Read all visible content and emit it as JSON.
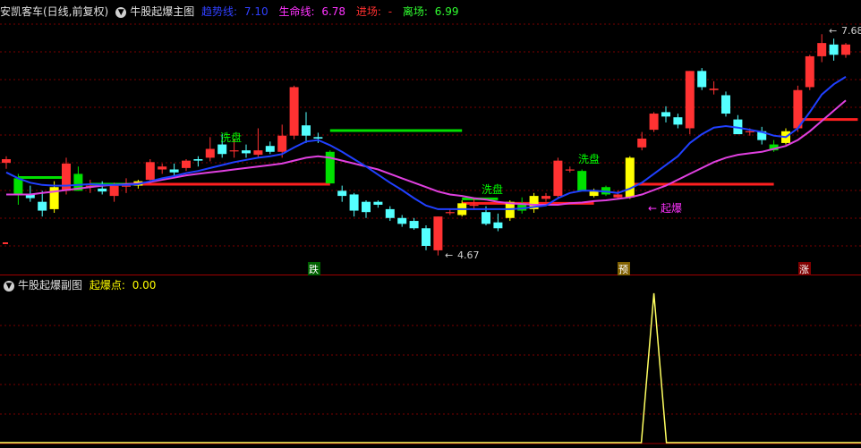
{
  "main_panel": {
    "stock_name": "安凯客车(日线,前复权)",
    "indicator_name": "牛股起爆主图",
    "values": [
      {
        "label": "趋势线:",
        "value": "7.10",
        "color": "#3040ff"
      },
      {
        "label": "生命线:",
        "value": "6.78",
        "color": "#ff33ff"
      },
      {
        "label": "进场:",
        "value": "-",
        "color": "#ff3030"
      },
      {
        "label": "离场:",
        "value": "6.99",
        "color": "#30ff30"
      }
    ],
    "annotations": {
      "wash1": "洗盘",
      "wash2": "洗盘",
      "wash3": "洗盘",
      "low_price": "4.67",
      "high_price": "7.68",
      "launch": "起爆"
    },
    "markers": [
      "跌",
      "预",
      "涨"
    ]
  },
  "sub_panel": {
    "indicator_name": "牛股起爆副图",
    "value_label": "起爆点:",
    "value": "0.00"
  },
  "colors": {
    "up": "#ff3232",
    "down": "#54ffff",
    "green": "#00e000",
    "yellow": "#ffff00",
    "trend": "#2040ff",
    "life": "#e040e0",
    "grid": "#7a0000"
  },
  "candles": [
    {
      "o": 5.93,
      "h": 6.02,
      "l": 5.85,
      "c": 5.98
    },
    {
      "o": 5.72,
      "h": 5.78,
      "l": 5.36,
      "c": 5.5,
      "k": "g"
    },
    {
      "o": 5.5,
      "h": 5.62,
      "l": 5.4,
      "c": 5.45
    },
    {
      "o": 5.4,
      "h": 5.55,
      "l": 5.2,
      "c": 5.28
    },
    {
      "o": 5.3,
      "h": 5.68,
      "l": 5.25,
      "c": 5.6,
      "k": "y"
    },
    {
      "o": 5.55,
      "h": 6.0,
      "l": 5.5,
      "c": 5.92
    },
    {
      "o": 5.78,
      "h": 5.88,
      "l": 5.55,
      "c": 5.55,
      "k": "g"
    },
    {
      "o": 5.62,
      "h": 5.7,
      "l": 5.52,
      "c": 5.62
    },
    {
      "o": 5.58,
      "h": 5.68,
      "l": 5.5,
      "c": 5.54
    },
    {
      "o": 5.48,
      "h": 5.66,
      "l": 5.4,
      "c": 5.62
    },
    {
      "o": 5.62,
      "h": 5.72,
      "l": 5.52,
      "c": 5.62
    },
    {
      "o": 5.62,
      "h": 5.7,
      "l": 5.58,
      "c": 5.68,
      "k": "y"
    },
    {
      "o": 5.7,
      "h": 5.98,
      "l": 5.65,
      "c": 5.94
    },
    {
      "o": 5.84,
      "h": 5.92,
      "l": 5.78,
      "c": 5.88
    },
    {
      "o": 5.84,
      "h": 5.92,
      "l": 5.76,
      "c": 5.8
    },
    {
      "o": 5.86,
      "h": 5.98,
      "l": 5.82,
      "c": 5.96
    },
    {
      "o": 5.98,
      "h": 6.02,
      "l": 5.88,
      "c": 5.96
    },
    {
      "o": 6.0,
      "h": 6.28,
      "l": 5.95,
      "c": 6.12
    },
    {
      "o": 6.18,
      "h": 6.32,
      "l": 6.0,
      "c": 6.05
    },
    {
      "o": 6.1,
      "h": 6.25,
      "l": 6.0,
      "c": 6.1
    },
    {
      "o": 6.1,
      "h": 6.18,
      "l": 6.0,
      "c": 6.06
    },
    {
      "o": 6.04,
      "h": 6.4,
      "l": 6.0,
      "c": 6.1
    },
    {
      "o": 6.16,
      "h": 6.22,
      "l": 6.05,
      "c": 6.08
    },
    {
      "o": 6.08,
      "h": 6.45,
      "l": 6.0,
      "c": 6.3
    },
    {
      "o": 6.3,
      "h": 6.98,
      "l": 6.25,
      "c": 6.96
    },
    {
      "o": 6.44,
      "h": 6.62,
      "l": 6.2,
      "c": 6.3
    },
    {
      "o": 6.28,
      "h": 6.34,
      "l": 6.2,
      "c": 6.26
    },
    {
      "o": 6.08,
      "h": 6.1,
      "l": 5.65,
      "c": 5.65,
      "k": "g"
    },
    {
      "o": 5.55,
      "h": 5.62,
      "l": 5.4,
      "c": 5.48
    },
    {
      "o": 5.5,
      "h": 5.52,
      "l": 5.2,
      "c": 5.28
    },
    {
      "o": 5.4,
      "h": 5.42,
      "l": 5.18,
      "c": 5.26
    },
    {
      "o": 5.4,
      "h": 5.42,
      "l": 5.32,
      "c": 5.36
    },
    {
      "o": 5.3,
      "h": 5.34,
      "l": 5.14,
      "c": 5.18
    },
    {
      "o": 5.18,
      "h": 5.22,
      "l": 5.06,
      "c": 5.1
    },
    {
      "o": 5.14,
      "h": 5.18,
      "l": 5.02,
      "c": 5.04
    },
    {
      "o": 5.04,
      "h": 5.08,
      "l": 4.74,
      "c": 4.8
    },
    {
      "o": 4.74,
      "h": 5.2,
      "l": 4.67,
      "c": 5.2
    },
    {
      "o": 5.26,
      "h": 5.3,
      "l": 5.22,
      "c": 5.26
    },
    {
      "o": 5.22,
      "h": 5.42,
      "l": 5.2,
      "c": 5.38,
      "k": "y"
    },
    {
      "o": 5.36,
      "h": 5.44,
      "l": 5.3,
      "c": 5.36
    },
    {
      "o": 5.26,
      "h": 5.34,
      "l": 5.08,
      "c": 5.1
    },
    {
      "o": 5.12,
      "h": 5.24,
      "l": 5.0,
      "c": 5.04
    },
    {
      "o": 5.18,
      "h": 5.42,
      "l": 5.14,
      "c": 5.4,
      "k": "y"
    },
    {
      "o": 5.38,
      "h": 5.46,
      "l": 5.24,
      "c": 5.28,
      "k": "g"
    },
    {
      "o": 5.3,
      "h": 5.52,
      "l": 5.25,
      "c": 5.48,
      "k": "y"
    },
    {
      "o": 5.44,
      "h": 5.52,
      "l": 5.4,
      "c": 5.48
    },
    {
      "o": 5.48,
      "h": 6.0,
      "l": 5.45,
      "c": 5.96
    },
    {
      "o": 5.84,
      "h": 5.88,
      "l": 5.8,
      "c": 5.84
    },
    {
      "o": 5.82,
      "h": 5.84,
      "l": 5.55,
      "c": 5.55,
      "k": "g"
    },
    {
      "o": 5.48,
      "h": 5.58,
      "l": 5.46,
      "c": 5.56,
      "k": "y"
    },
    {
      "o": 5.6,
      "h": 5.62,
      "l": 5.48,
      "c": 5.5,
      "k": "g"
    },
    {
      "o": 5.46,
      "h": 5.55,
      "l": 5.44,
      "c": 5.5
    },
    {
      "o": 5.46,
      "h": 6.02,
      "l": 5.44,
      "c": 6.0,
      "k": "y"
    },
    {
      "o": 6.14,
      "h": 6.35,
      "l": 6.1,
      "c": 6.26
    },
    {
      "o": 6.38,
      "h": 6.62,
      "l": 6.35,
      "c": 6.6
    },
    {
      "o": 6.62,
      "h": 6.7,
      "l": 6.48,
      "c": 6.56
    },
    {
      "o": 6.55,
      "h": 6.6,
      "l": 6.4,
      "c": 6.45
    },
    {
      "o": 6.4,
      "h": 7.18,
      "l": 6.32,
      "c": 7.18
    },
    {
      "o": 7.18,
      "h": 7.22,
      "l": 6.92,
      "c": 6.96
    },
    {
      "o": 6.92,
      "h": 7.04,
      "l": 6.86,
      "c": 6.94
    },
    {
      "o": 6.85,
      "h": 6.9,
      "l": 6.56,
      "c": 6.6
    },
    {
      "o": 6.52,
      "h": 6.58,
      "l": 6.32,
      "c": 6.32
    },
    {
      "o": 6.36,
      "h": 6.4,
      "l": 6.3,
      "c": 6.36
    },
    {
      "o": 6.36,
      "h": 6.42,
      "l": 6.18,
      "c": 6.24
    },
    {
      "o": 6.1,
      "h": 6.24,
      "l": 6.08,
      "c": 6.18,
      "k": "g"
    },
    {
      "o": 6.2,
      "h": 6.4,
      "l": 6.18,
      "c": 6.36,
      "k": "y"
    },
    {
      "o": 6.4,
      "h": 6.98,
      "l": 6.35,
      "c": 6.92
    },
    {
      "o": 6.96,
      "h": 7.4,
      "l": 6.92,
      "c": 7.38
    },
    {
      "o": 7.38,
      "h": 7.68,
      "l": 7.3,
      "c": 7.56
    },
    {
      "o": 7.54,
      "h": 7.62,
      "l": 7.32,
      "c": 7.4
    },
    {
      "o": 7.4,
      "h": 7.56,
      "l": 7.36,
      "c": 7.54
    }
  ],
  "trend_line": [
    5.8,
    5.72,
    5.66,
    5.63,
    5.62,
    5.62,
    5.63,
    5.64,
    5.63,
    5.63,
    5.63,
    5.64,
    5.68,
    5.72,
    5.75,
    5.79,
    5.82,
    5.86,
    5.9,
    5.94,
    5.97,
    6.0,
    6.02,
    6.05,
    6.14,
    6.22,
    6.24,
    6.17,
    6.08,
    5.98,
    5.88,
    5.77,
    5.66,
    5.56,
    5.45,
    5.35,
    5.3,
    5.3,
    5.3,
    5.3,
    5.3,
    5.3,
    5.3,
    5.31,
    5.33,
    5.35,
    5.45,
    5.52,
    5.55,
    5.55,
    5.54,
    5.52,
    5.58,
    5.66,
    5.78,
    5.9,
    6.02,
    6.2,
    6.32,
    6.41,
    6.43,
    6.41,
    6.38,
    6.35,
    6.3,
    6.28,
    6.4,
    6.62,
    6.86,
    7.0,
    7.1
  ],
  "life_line": [
    5.5,
    5.5,
    5.5,
    5.52,
    5.54,
    5.56,
    5.58,
    5.6,
    5.62,
    5.63,
    5.64,
    5.65,
    5.67,
    5.7,
    5.73,
    5.76,
    5.78,
    5.8,
    5.82,
    5.84,
    5.86,
    5.88,
    5.9,
    5.92,
    5.96,
    6.0,
    6.02,
    6.0,
    5.96,
    5.92,
    5.88,
    5.84,
    5.78,
    5.72,
    5.66,
    5.6,
    5.54,
    5.5,
    5.48,
    5.45,
    5.43,
    5.4,
    5.38,
    5.37,
    5.36,
    5.36,
    5.36,
    5.38,
    5.39,
    5.41,
    5.42,
    5.44,
    5.46,
    5.5,
    5.56,
    5.62,
    5.7,
    5.78,
    5.86,
    5.94,
    6.0,
    6.04,
    6.06,
    6.08,
    6.12,
    6.16,
    6.24,
    6.36,
    6.5,
    6.64,
    6.78
  ],
  "level_lines": [
    {
      "from": 1,
      "to": 5,
      "price": 5.73,
      "color": "green"
    },
    {
      "from": 7,
      "to": 11,
      "price": 5.64,
      "color": "green"
    },
    {
      "from": 11,
      "to": 27,
      "price": 5.64,
      "color": "red"
    },
    {
      "from": 27,
      "to": 38,
      "price": 6.37,
      "color": "green"
    },
    {
      "from": 38,
      "to": 41,
      "price": 5.44,
      "color": "green"
    },
    {
      "from": 38,
      "to": 49,
      "price": 5.38,
      "color": "red"
    },
    {
      "from": 52,
      "to": 64,
      "price": 5.64,
      "color": "red"
    },
    {
      "from": 66,
      "to": 71,
      "price": 6.52,
      "color": "red"
    }
  ],
  "sub_signal": {
    "index": 54,
    "peak": 1.0
  }
}
